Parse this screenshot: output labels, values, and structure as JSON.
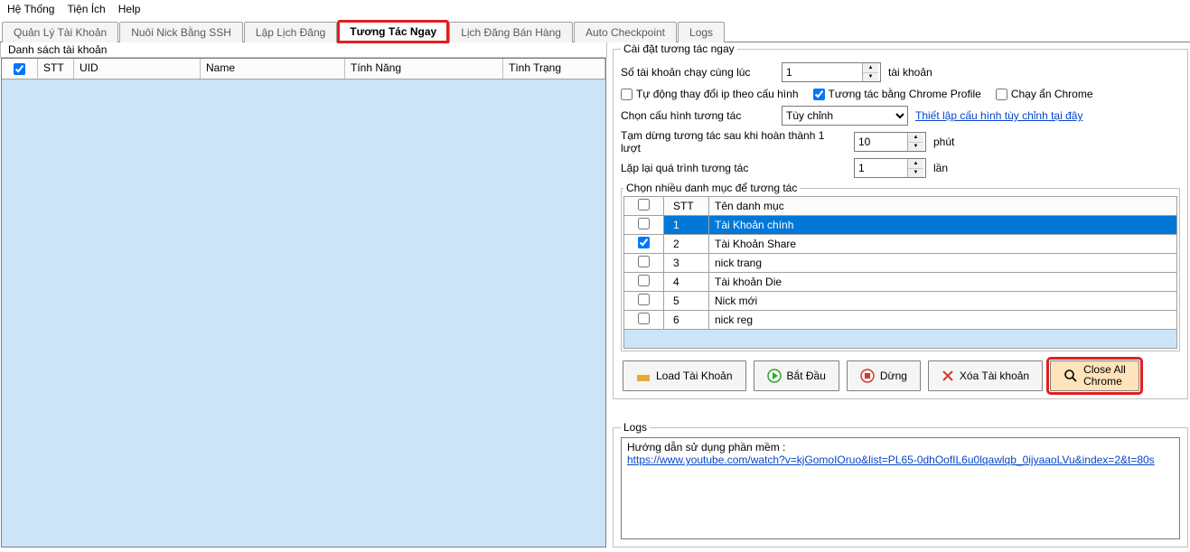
{
  "menubar": {
    "m1": "Hệ Thống",
    "m2": "Tiện Ích",
    "m3": "Help"
  },
  "tabs": {
    "t0": "Quản Lý Tài Khoản",
    "t1": "Nuôi Nick Bằng SSH",
    "t2": "Lập Lịch Đăng",
    "t3": "Tương Tác Ngay",
    "t4": "Lịch Đăng Bán Hàng",
    "t5": "Auto Checkpoint",
    "t6": "Logs"
  },
  "left": {
    "group": "Danh sách tài khoản",
    "h_stt": "STT",
    "h_uid": "UID",
    "h_name": "Name",
    "h_feat": "Tính Năng",
    "h_stat": "Tình Trạng"
  },
  "settings": {
    "legend": "Cài đặt tương tác ngay",
    "l_concurrent": "Số tài khoản chạy cùng lúc",
    "v_concurrent": "1",
    "u_concurrent": "tài khoản",
    "c_autoip": "Tự động thay đổi ip theo cấu hình",
    "c_chromeprof": "Tương tác bằng Chrome Profile",
    "c_hiddenchrome": "Chạy ẩn Chrome",
    "l_config": "Chọn cấu hình tương tác",
    "v_config": "Tùy chỉnh",
    "link_config": "Thiết lập cấu hình tùy chỉnh tại đây",
    "l_pause": "Tạm dừng tương tác sau khi hoàn thành 1 lượt",
    "v_pause": "10",
    "u_pause": "phút",
    "l_repeat": "Lặp lại quá trình tương tác",
    "v_repeat": "1",
    "u_repeat": "lần",
    "cat_legend": "Chọn nhiều danh mục để tương tác",
    "cat_h_stt": "STT",
    "cat_h_name": "Tên danh mục",
    "cats": [
      {
        "n": "1",
        "name": "Tài Khoản chính",
        "checked": false,
        "selected": true
      },
      {
        "n": "2",
        "name": "Tài Khoản Share",
        "checked": true,
        "selected": false
      },
      {
        "n": "3",
        "name": "nick trang",
        "checked": false,
        "selected": false
      },
      {
        "n": "4",
        "name": "Tài khoản Die",
        "checked": false,
        "selected": false
      },
      {
        "n": "5",
        "name": "Nick mới",
        "checked": false,
        "selected": false
      },
      {
        "n": "6",
        "name": "nick reg",
        "checked": false,
        "selected": false
      }
    ]
  },
  "buttons": {
    "load": "Load Tài Khoản",
    "start": "Bắt Đầu",
    "stop": "Dừng",
    "delete": "Xóa Tài khoản",
    "closeall_l1": "Close All",
    "closeall_l2": "Chrome"
  },
  "logs": {
    "legend": "Logs",
    "intro": "Hướng dẫn sử dụng phần mềm :",
    "url": "https://www.youtube.com/watch?v=kjGomoIOruo&list=PL65-0dhOofIL6u0lqawlqb_0ijyaaoLVu&index=2&t=80s"
  }
}
